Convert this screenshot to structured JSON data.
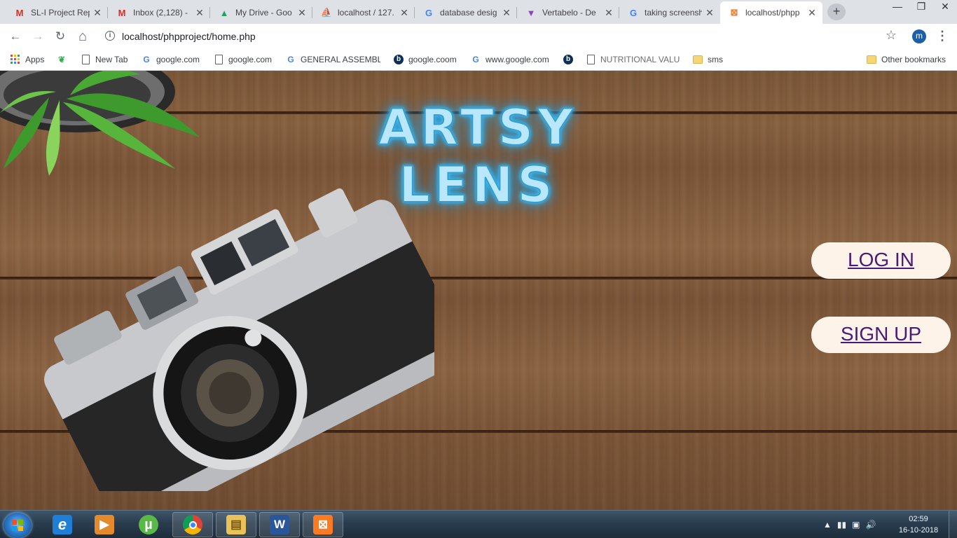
{
  "browser": {
    "tabs": [
      {
        "label": "SL-I Project Rep",
        "icon": "gmail-icon",
        "color": "#d93025",
        "glyph": "M"
      },
      {
        "label": "Inbox (2,128) - ",
        "icon": "gmail-icon",
        "color": "#d93025",
        "glyph": "M"
      },
      {
        "label": "My Drive - Goo",
        "icon": "drive-icon",
        "color": "#1ea362",
        "glyph": "▲"
      },
      {
        "label": "localhost / 127.",
        "icon": "phpmyadmin-icon",
        "color": "#e67e22",
        "glyph": "⛵"
      },
      {
        "label": "database desig",
        "icon": "google-icon",
        "color": "#4285f4",
        "glyph": "G"
      },
      {
        "label": "Vertabelo - De",
        "icon": "vertabelo-icon",
        "color": "#8e44ad",
        "glyph": "▼"
      },
      {
        "label": "taking screensh",
        "icon": "google-icon",
        "color": "#4285f4",
        "glyph": "G"
      },
      {
        "label": "localhost/phpp",
        "icon": "xampp-icon",
        "color": "#fb7a24",
        "glyph": "⊠"
      }
    ],
    "new_tab_glyph": "+",
    "window_controls": {
      "minimize": "—",
      "maximize": "❐",
      "close": "✕"
    },
    "nav": {
      "back": "←",
      "forward": "→",
      "reload": "↻",
      "home": "⌂"
    },
    "url": "localhost/phpproject/home.php",
    "info_glyph": "i",
    "star_glyph": "☆",
    "profile_initial": "m",
    "menu_glyph": "⋮",
    "bookmarks": [
      {
        "label": "Apps",
        "icon": "apps-grid-icon"
      },
      {
        "label": "",
        "icon": "colorful-leaf-icon"
      },
      {
        "label": "New Tab",
        "icon": "page-icon"
      },
      {
        "label": "google.com",
        "icon": "google-icon"
      },
      {
        "label": "google.com",
        "icon": "page-icon"
      },
      {
        "label": "GENERAL ASSEMBLY:",
        "icon": "google-icon"
      },
      {
        "label": "google.coom",
        "icon": "bing-icon"
      },
      {
        "label": "www.google.com",
        "icon": "google-icon"
      },
      {
        "label": "",
        "icon": "bing-icon"
      },
      {
        "label": "NUTRITIONAL VALUE",
        "icon": "page-icon"
      },
      {
        "label": "sms",
        "icon": "folder-icon"
      }
    ],
    "other_bookmarks": "Other bookmarks"
  },
  "page": {
    "brand": "ARTSY LENS",
    "login_label": "LOG IN",
    "signup_label": "SIGN UP"
  },
  "taskbar": {
    "apps": [
      {
        "name": "internet-explorer-icon",
        "glyph": "e",
        "color": "#1f7fd6"
      },
      {
        "name": "media-player-icon",
        "glyph": "▶",
        "color": "#e28a2c"
      },
      {
        "name": "utorrent-icon",
        "glyph": "µ",
        "color": "#58b947"
      },
      {
        "name": "chrome-icon",
        "glyph": "◉",
        "color": "#db4437"
      },
      {
        "name": "file-explorer-icon",
        "glyph": "▤",
        "color": "#e9c25a"
      },
      {
        "name": "word-icon",
        "glyph": "W",
        "color": "#2b579a"
      },
      {
        "name": "xampp-icon",
        "glyph": "⊠",
        "color": "#fb7a24"
      }
    ],
    "tray_icons": [
      "▲",
      "▮▮",
      "▣",
      "🔊"
    ],
    "time": "02:59",
    "date": "16-10-2018"
  }
}
